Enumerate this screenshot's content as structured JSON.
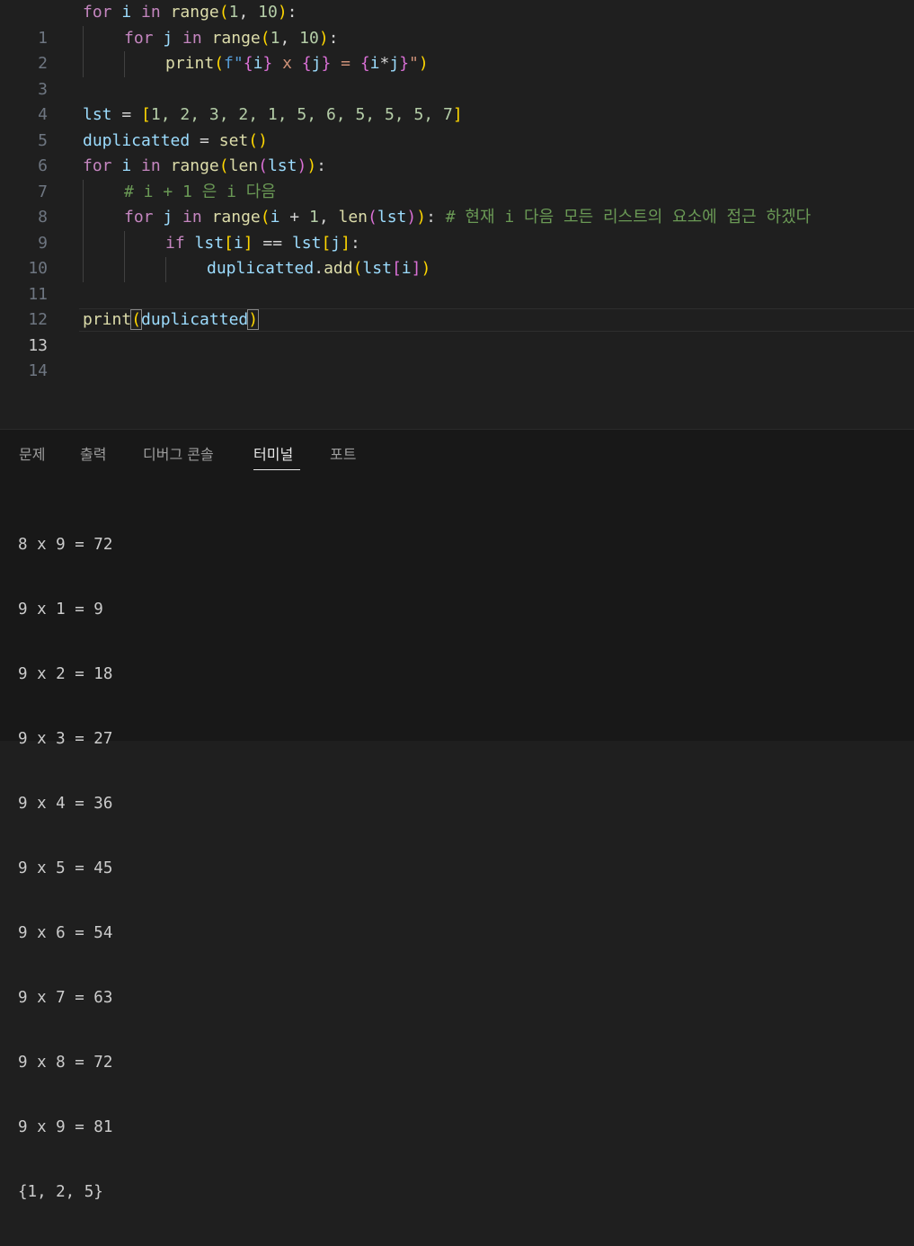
{
  "editor": {
    "active_line": "13",
    "lines": [
      {
        "num": "1"
      },
      {
        "num": "2"
      },
      {
        "num": "3"
      },
      {
        "num": "4"
      },
      {
        "num": "5"
      },
      {
        "num": "6"
      },
      {
        "num": "7"
      },
      {
        "num": "8"
      },
      {
        "num": "9"
      },
      {
        "num": "10"
      },
      {
        "num": "11"
      },
      {
        "num": "12"
      },
      {
        "num": "13"
      },
      {
        "num": "14"
      }
    ],
    "code": {
      "l1": [
        "for",
        "i",
        "in",
        "range",
        "(",
        "1",
        ", ",
        "10",
        ")",
        ":"
      ],
      "l2": [
        "for",
        "j",
        "in",
        "range",
        "(",
        "1",
        ", ",
        "10",
        ")",
        ":"
      ],
      "l3": [
        "print",
        "(",
        "f\"",
        "{",
        "i",
        "}",
        " x ",
        "{",
        "j",
        "}",
        " = ",
        "{",
        "i",
        "*",
        "j",
        "}",
        "\"",
        ")"
      ],
      "l5": [
        "lst",
        " = ",
        "[",
        "1, 2, 3, 2, 1, 5, 6, 5, 5, 5, 7",
        "]"
      ],
      "l6": [
        "duplicatted",
        " = ",
        "set",
        "(",
        ")"
      ],
      "l7": [
        "for",
        "i",
        "in",
        "range",
        "(",
        "len",
        "(",
        "lst",
        ")",
        ")",
        ":"
      ],
      "l8": [
        "# i + 1 은 i 다음"
      ],
      "l9": [
        "for",
        "j",
        "in",
        "range",
        "(",
        "i",
        " + ",
        "1",
        ", ",
        "len",
        "(",
        "lst",
        ")",
        ")",
        ":",
        " # 현재 i 다음 모든 리스트의 요소에 접근 하겠다"
      ],
      "l10": [
        "if",
        "lst",
        "[",
        "i",
        "]",
        " == ",
        "lst",
        "[",
        "j",
        "]",
        ":"
      ],
      "l11": [
        "duplicatted",
        ".",
        "add",
        "(",
        "lst",
        "[",
        "i",
        "]",
        ")"
      ],
      "l13": [
        "print",
        "(",
        "duplicatted",
        ")"
      ]
    }
  },
  "panel": {
    "tabs": [
      "문제",
      "출력",
      "디버그 콘솔",
      "터미널",
      "포트"
    ],
    "active_tab": "터미널"
  },
  "terminal": {
    "output": [
      "8 x 9 = 72",
      "9 x 1 = 9",
      "9 x 2 = 18",
      "9 x 3 = 27",
      "9 x 4 = 36",
      "9 x 5 = 45",
      "9 x 6 = 54",
      "9 x 7 = 63",
      "9 x 8 = 72",
      "9 x 9 = 81",
      "{1, 2, 5}"
    ]
  }
}
